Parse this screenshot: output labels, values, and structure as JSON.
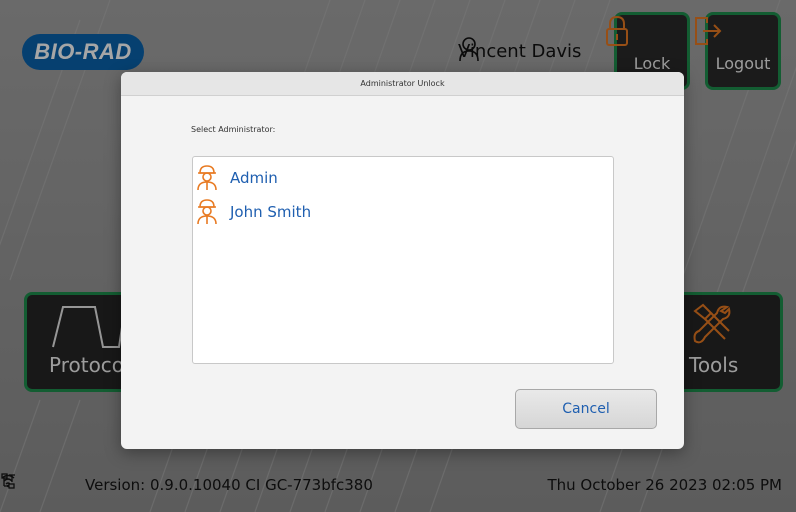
{
  "header": {
    "logo_text": "BIO-RAD",
    "user_name": "Vincent Davis",
    "lock_label": "Lock",
    "logout_label": "Logout"
  },
  "tiles": {
    "protocols_label": "Protoco",
    "tools_label": "Tools"
  },
  "footer": {
    "version": "Version: 0.9.0.10040 CI GC-773bfc380",
    "datetime": "Thu October 26 2023 02:05 PM"
  },
  "dialog": {
    "title": "Administrator Unlock",
    "select_label": "Select Administrator:",
    "administrators": [
      {
        "name": "Admin"
      },
      {
        "name": "John Smith"
      }
    ],
    "cancel_label": "Cancel"
  },
  "colors": {
    "accent_green": "#1e8f4e",
    "brand_blue": "#0a63ad",
    "avatar_orange": "#e87a22",
    "link_blue": "#1f5fb0"
  },
  "icons": {
    "user": "user-icon",
    "lock": "lock-icon",
    "logout": "logout-icon",
    "protocols": "protocol-waveform-icon",
    "tools": "tools-icon",
    "wifi": "wifi-icon",
    "network": "network-icon",
    "admin_avatar": "admin-avatar-icon"
  }
}
